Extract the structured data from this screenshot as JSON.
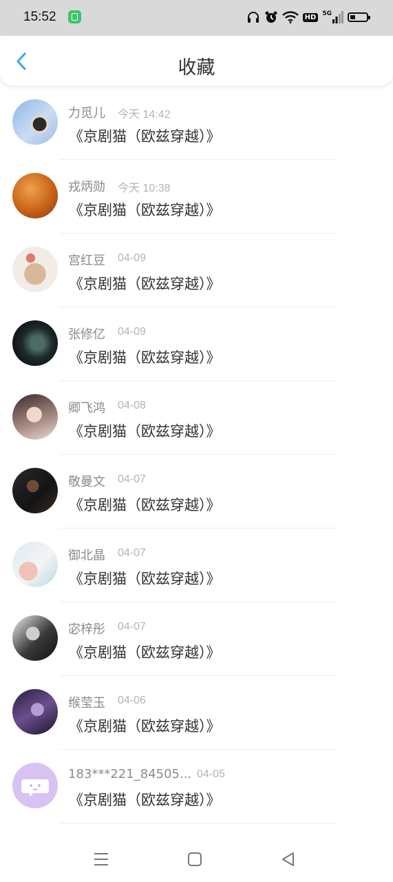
{
  "status_bar": {
    "time": "15:52",
    "network": "5G",
    "hd": "HD",
    "icons": [
      "app-badge-icon",
      "headphones-icon",
      "alarm-icon",
      "wifi-icon",
      "hd-icon",
      "signal-icon",
      "battery-icon"
    ]
  },
  "header": {
    "title": "收藏",
    "back_icon": "chevron-left-icon",
    "accent": "#3aa8e0"
  },
  "items": [
    {
      "name": "力觅儿",
      "date": "今天 14:42",
      "work": "《京剧猫（欧兹穿越）》"
    },
    {
      "name": "戎炳勋",
      "date": "今天 10:38",
      "work": "《京剧猫（欧兹穿越）》"
    },
    {
      "name": "宫红豆",
      "date": "04-09",
      "work": "《京剧猫（欧兹穿越）》"
    },
    {
      "name": "张修亿",
      "date": "04-09",
      "work": "《京剧猫（欧兹穿越）》"
    },
    {
      "name": "卿飞鸿",
      "date": "04-08",
      "work": "《京剧猫（欧兹穿越）》"
    },
    {
      "name": "敬曼文",
      "date": "04-07",
      "work": "《京剧猫（欧兹穿越）》"
    },
    {
      "name": "御北晶",
      "date": "04-07",
      "work": "《京剧猫（欧兹穿越）》"
    },
    {
      "name": "宓梓彤",
      "date": "04-07",
      "work": "《京剧猫（欧兹穿越）》"
    },
    {
      "name": "缑莹玉",
      "date": "04-06",
      "work": "《京剧猫（欧兹穿越）》"
    },
    {
      "name": "183***221_84505...",
      "date": "04-05",
      "work": "《京剧猫（欧兹穿越）》"
    }
  ],
  "nav_bar": {
    "icons": [
      "menu-icon",
      "home-square-icon",
      "back-triangle-icon"
    ]
  }
}
